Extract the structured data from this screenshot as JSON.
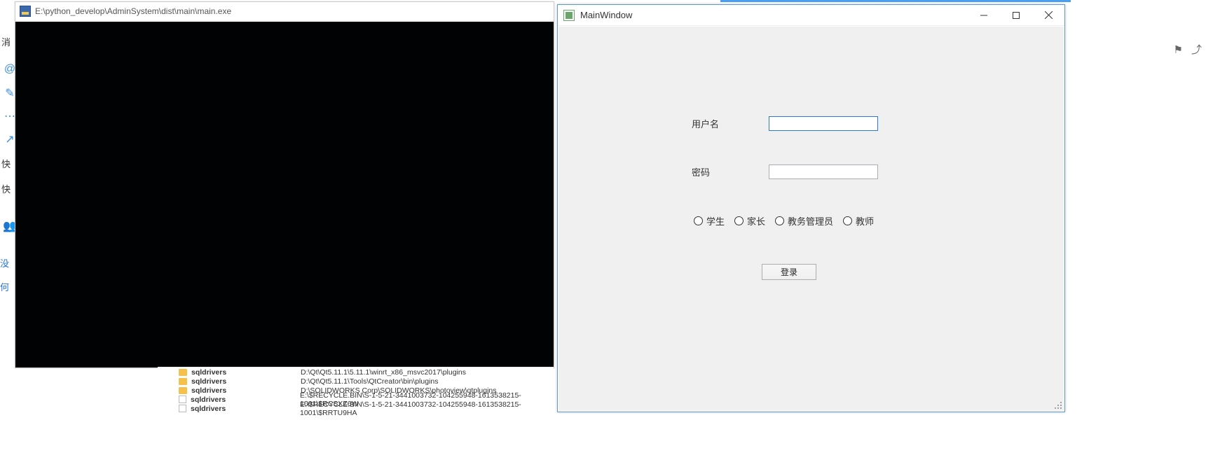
{
  "left_sidebar": {
    "msg_label": "消",
    "at_icon": "@",
    "edit_icon": "✎",
    "chat_icon": "⋯",
    "share_icon": "↗",
    "quick1": "快",
    "quick2": "快",
    "group_icon": "👥",
    "link1": "没",
    "link2": "何"
  },
  "console": {
    "title": "E:\\python_develop\\AdminSystem\\dist\\main\\main.exe"
  },
  "files": {
    "rows": [
      {
        "icon": "folder",
        "name": "sqldrivers",
        "path": "D:\\Qt\\Qt5.11.1\\5.11.1\\winrt_x86_msvc2017\\plugins"
      },
      {
        "icon": "folder",
        "name": "sqldrivers",
        "path": "D:\\Qt\\Qt5.11.1\\Tools\\QtCreator\\bin\\plugins"
      },
      {
        "icon": "folder",
        "name": "sqldrivers",
        "path": "D:\\SOLIDWORKS Corp\\SOLIDWORKS\\photoview\\qtplugins"
      },
      {
        "icon": "file",
        "name": "sqldrivers",
        "path": "E:\\$RECYCLE.BIN\\S-1-5-21-3441003732-104255948-1613538215-1001\\$RCSXZ6W"
      },
      {
        "icon": "file",
        "name": "sqldrivers",
        "path": "E:\\$RECYCLE.BIN\\S-1-5-21-3441003732-104255948-1613538215-1001\\$RRTU9HA"
      }
    ]
  },
  "qt": {
    "title": "MainWindow",
    "labels": {
      "username": "用户名",
      "password": "密码"
    },
    "inputs": {
      "username_value": "",
      "password_value": ""
    },
    "radios": {
      "student": "学生",
      "parent": "家长",
      "admin": "教务管理员",
      "teacher": "教师"
    },
    "login_button": "登录"
  },
  "right_icons": {
    "flag": "⚑",
    "share": "⤴"
  }
}
